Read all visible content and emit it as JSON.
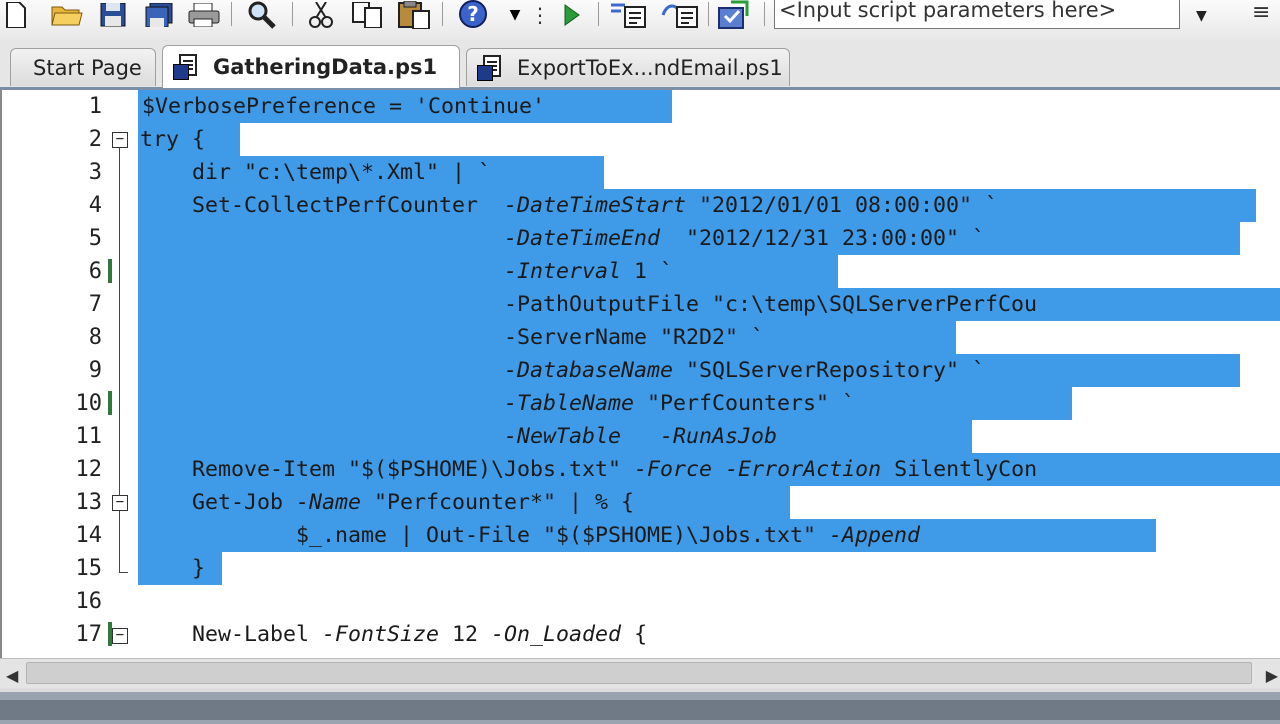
{
  "toolbar": {
    "params_placeholder": "<Input script parameters here>"
  },
  "tabs": [
    {
      "label": "Start Page",
      "active": false
    },
    {
      "label": "GatheringData.ps1",
      "active": true
    },
    {
      "label": "ExportToEx...ndEmail.ps1",
      "active": false
    }
  ],
  "editor": {
    "line_numbers": [
      "1",
      "2",
      "3",
      "4",
      "5",
      "6",
      "7",
      "8",
      "9",
      "10",
      "11",
      "12",
      "13",
      "14",
      "15",
      "16",
      "17"
    ],
    "lines": [
      {
        "text": "$VerbosePreference = 'Continue'"
      },
      {
        "text": "try {"
      },
      {
        "text": "    dir \"c:\\temp\\*.Xml\" | `"
      },
      {
        "text": "    Set-CollectPerfCounter  ",
        "param": "-DateTimeStart",
        "rest": " \"2012/01/01 08:00:00\" `"
      },
      {
        "text": "                            ",
        "param": "-DateTimeEnd",
        "rest": "  \"2012/12/31 23:00:00\" `"
      },
      {
        "text": "                            ",
        "param": "-Interval",
        "rest": " 1 `"
      },
      {
        "text": "                            -PathOutputFile \"c:\\temp\\SQLServerPerfCou"
      },
      {
        "text": "                            -ServerName \"R2D2\" `"
      },
      {
        "text": "                            ",
        "param": "-DatabaseName",
        "rest": " \"SQLServerRepository\" `"
      },
      {
        "text": "                            ",
        "param": "-TableName",
        "rest": " \"PerfCounters\" `"
      },
      {
        "text": "                            ",
        "param": "-NewTable",
        "rest": "   ",
        "param2": "-RunAsJob"
      },
      {
        "text": "    Remove-Item \"$($PSHOME)\\Jobs.txt\" ",
        "param": "-Force",
        "rest": " ",
        "param2": "-ErrorAction",
        "rest2": " SilentlyCon"
      },
      {
        "text": "    Get-Job ",
        "param": "-Name",
        "rest": " \"Perfcounter*\" | % {"
      },
      {
        "text": "            $_.name | Out-File \"$($PSHOME)\\Jobs.txt\" ",
        "param": "-Append"
      },
      {
        "text": "    }"
      },
      {
        "text": ""
      },
      {
        "text": "    New-Label ",
        "param": "-FontSize",
        "rest": " 12 ",
        "param2": "-On_Loaded",
        "rest2": " {"
      }
    ]
  },
  "colors": {
    "selection": "#3f9be8",
    "change_marker": "#2f7a3a"
  }
}
